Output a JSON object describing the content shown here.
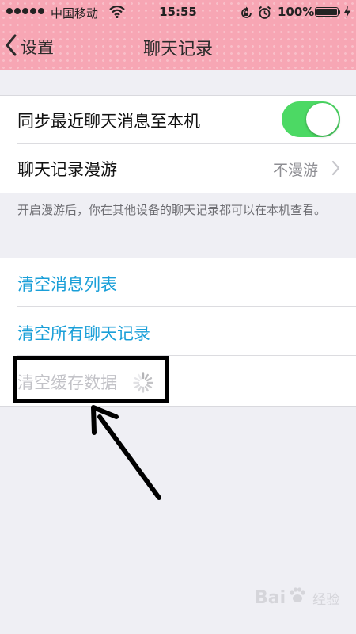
{
  "status_bar": {
    "carrier": "中国移动",
    "time": "15:55",
    "battery_percent": "100%",
    "battery_level": 1.0,
    "icons": [
      "signal-dots-icon",
      "wifi-icon",
      "rotation-lock-icon",
      "alarm-icon",
      "battery-icon",
      "charging-bolt-icon"
    ]
  },
  "nav": {
    "back_label": "设置",
    "title": "聊天记录"
  },
  "sync_group": {
    "sync_recent_label": "同步最近聊天消息至本机",
    "sync_recent_on": true,
    "roaming_label": "聊天记录漫游",
    "roaming_value": "不漫游"
  },
  "roaming_note": "开启漫游后，你在其他设备的聊天记录都可以在本机查看。",
  "clear_group": {
    "clear_message_list": "清空消息列表",
    "clear_all_history": "清空所有聊天记录",
    "clear_cache": "清空缓存数据"
  },
  "watermark": {
    "brand_left": "Bai",
    "brand_right": "",
    "sub": "经验"
  },
  "colors": {
    "header_bg": "#f7a6b4",
    "toggle_on": "#4cd964",
    "action_text": "#1a9fd8",
    "disabled_text": "#c2c2c7",
    "page_bg": "#efeff4"
  }
}
